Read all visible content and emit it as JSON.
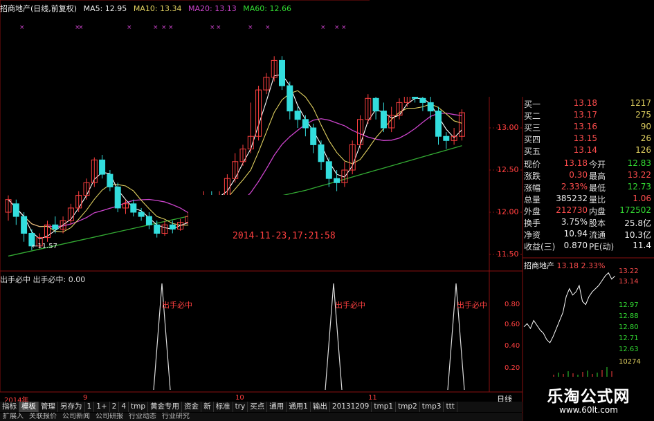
{
  "header": {
    "stock_title": "招商地产(日线,前复权)",
    "ma5": "MA5: 12.95",
    "ma10": "MA10: 13.34",
    "ma20": "MA20: 13.13",
    "ma60": "MA60: 12.66"
  },
  "price_axis": [
    "13.00",
    "12.50",
    "12.00",
    "11.50"
  ],
  "low_marker": "←11.57",
  "timestamp": "2014-11-23,17:21:58",
  "indicator": {
    "label": "出手必中  出手必中: 0.00",
    "signal_text": "出手必中",
    "axis": [
      "0.80",
      "0.60",
      "0.40",
      "0.20"
    ]
  },
  "x_axis": {
    "year": "2014年",
    "m9": "9",
    "m10": "10",
    "m11": "11",
    "period": "日线"
  },
  "quotes": {
    "bids": [
      {
        "label": "买一",
        "price": "13.18",
        "vol": "1217"
      },
      {
        "label": "买二",
        "price": "13.17",
        "vol": "275"
      },
      {
        "label": "买三",
        "price": "13.16",
        "vol": "90"
      },
      {
        "label": "买四",
        "price": "13.15",
        "vol": "26"
      },
      {
        "label": "买五",
        "price": "13.14",
        "vol": "126"
      }
    ],
    "stats": [
      {
        "l1": "现价",
        "v1": "13.18",
        "c1": "red",
        "l2": "今开",
        "v2": "12.83",
        "c2": "green"
      },
      {
        "l1": "涨跌",
        "v1": "0.30",
        "c1": "red",
        "l2": "最高",
        "v2": "13.22",
        "c2": "red"
      },
      {
        "l1": "涨幅",
        "v1": "2.33%",
        "c1": "red",
        "l2": "最低",
        "v2": "12.73",
        "c2": "green"
      },
      {
        "l1": "总量",
        "v1": "385232",
        "c1": "white",
        "l2": "量比",
        "v2": "1.06",
        "c2": "red"
      },
      {
        "l1": "外盘",
        "v1": "212730",
        "c1": "red",
        "l2": "内盘",
        "v2": "172502",
        "c2": "green"
      },
      {
        "l1": "换手",
        "v1": "3.75%",
        "c1": "white",
        "l2": "股本",
        "v2": "25.8亿",
        "c2": "white"
      },
      {
        "l1": "净资",
        "v1": "10.94",
        "c1": "white",
        "l2": "流通",
        "v2": "10.3亿",
        "c2": "white"
      },
      {
        "l1": "收益(三)",
        "v1": "0.870",
        "c1": "white",
        "l2": "PE(动)",
        "v2": "11.4",
        "c2": "white"
      }
    ]
  },
  "mini_chart": {
    "name": "招商地产",
    "price": "13.18",
    "pct": "2.33%",
    "ticks": [
      "13.22",
      "13.14",
      "12.97",
      "12.88",
      "12.80",
      "12.71",
      "12.63"
    ],
    "volume": "10274"
  },
  "tabs": [
    "指标",
    "模板",
    "管理",
    "另存为",
    "1",
    "1+",
    "2",
    "4",
    "tmp",
    "黄金专用",
    "资金",
    "新",
    "标准",
    "try",
    "买点",
    "通用",
    "通用1",
    "输出",
    "20131209",
    "tmp1",
    "tmp2",
    "tmp3",
    "ttt"
  ],
  "bottom_tabs": [
    "扩展入",
    "关联报价",
    "公司新闻",
    "公司研报",
    "行业动态",
    "行业研究"
  ],
  "watermark": {
    "main": "乐淘公式网",
    "sub": "www.60lt.com"
  },
  "colors": {
    "up": "#ff4040",
    "down": "#33dddd",
    "ma5": "#ffffff",
    "ma10": "#e0d060",
    "ma20": "#cc44cc",
    "ma60": "#33aa33"
  }
}
